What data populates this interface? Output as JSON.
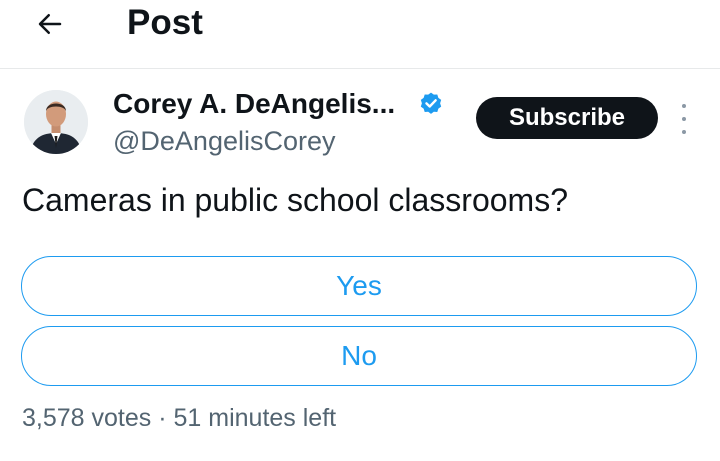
{
  "header": {
    "title": "Post"
  },
  "author": {
    "name": "Corey A. DeAngelis...",
    "handle": "@DeAngelisCorey",
    "verified": true
  },
  "subscribe_label": "Subscribe",
  "post": {
    "text": "Cameras in public school classrooms?"
  },
  "poll": {
    "options": [
      {
        "label": "Yes"
      },
      {
        "label": "No"
      }
    ],
    "votes": "3,578 votes",
    "separator": "·",
    "time_left": "51 minutes left"
  },
  "colors": {
    "accent": "#1d9bf0",
    "text": "#0f1419",
    "secondary_text": "#536471",
    "subscribe_bg": "#0f1419"
  },
  "icons": {
    "back": "arrow-left-icon",
    "verified": "verified-badge-icon",
    "more": "more-vertical-icon"
  }
}
